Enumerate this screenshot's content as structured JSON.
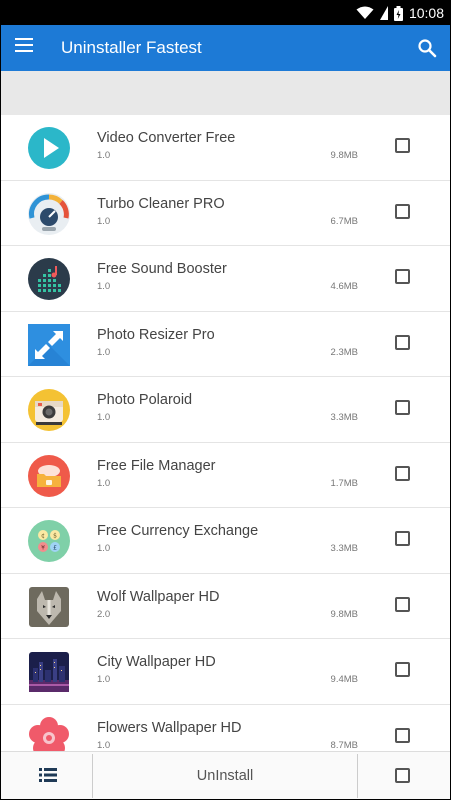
{
  "status_bar": {
    "time": "10:08"
  },
  "app_bar": {
    "title": "Uninstaller Fastest"
  },
  "apps": [
    {
      "name": "Video Converter Free",
      "version": "1.0",
      "size": "9.8MB",
      "icon": "play-icon"
    },
    {
      "name": "Turbo Cleaner PRO",
      "version": "1.0",
      "size": "6.7MB",
      "icon": "speedometer-icon"
    },
    {
      "name": "Free Sound Booster",
      "version": "1.0",
      "size": "4.6MB",
      "icon": "equalizer-icon"
    },
    {
      "name": "Photo Resizer Pro",
      "version": "1.0",
      "size": "2.3MB",
      "icon": "resize-arrows-icon"
    },
    {
      "name": "Photo Polaroid",
      "version": "1.0",
      "size": "3.3MB",
      "icon": "camera-icon"
    },
    {
      "name": "Free File Manager",
      "version": "1.0",
      "size": "1.7MB",
      "icon": "folder-icon"
    },
    {
      "name": "Free Currency Exchange",
      "version": "1.0",
      "size": "3.3MB",
      "icon": "currency-icon"
    },
    {
      "name": "Wolf Wallpaper HD",
      "version": "2.0",
      "size": "9.8MB",
      "icon": "wolf-image-icon"
    },
    {
      "name": "City Wallpaper HD",
      "version": "1.0",
      "size": "9.4MB",
      "icon": "city-image-icon"
    },
    {
      "name": "Flowers Wallpaper HD",
      "version": "1.0",
      "size": "8.7MB",
      "icon": "flower-icon"
    }
  ],
  "bottom_bar": {
    "uninstall_label": "UnInstall"
  },
  "colors": {
    "primary": "#1d7ad6",
    "background": "#ececec"
  }
}
